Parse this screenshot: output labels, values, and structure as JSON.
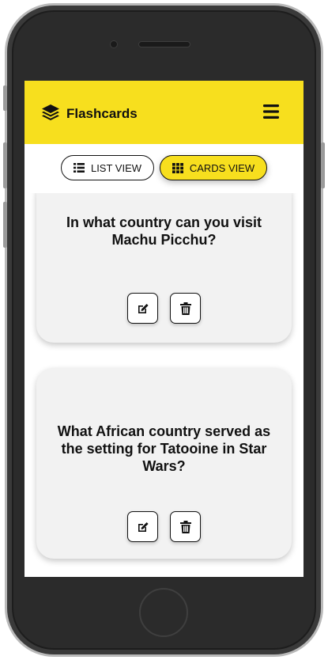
{
  "app": {
    "title": "Flashcards",
    "accent_color": "#f7df1e",
    "brand_icon": "layers-icon",
    "menu_icon": "hamburger-menu-icon"
  },
  "view_toggle": {
    "list_label": "LIST VIEW",
    "list_icon": "list-icon",
    "cards_label": "CARDS VIEW",
    "cards_icon": "grid-icon",
    "active": "cards"
  },
  "cards": [
    {
      "question": "In what country can you visit Machu Picchu?",
      "edit_icon": "edit-icon",
      "delete_icon": "trash-icon"
    },
    {
      "question": "What African country served as the setting for Tatooine in Star Wars?",
      "edit_icon": "edit-icon",
      "delete_icon": "trash-icon"
    }
  ]
}
